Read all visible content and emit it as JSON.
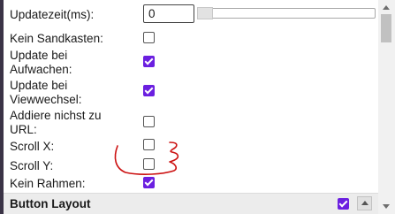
{
  "settings": {
    "update_interval": {
      "label": "Updatezeit(ms):",
      "value": "0",
      "slider_level": 0
    },
    "rows": [
      {
        "label_lines": [
          "Kein Sandkasten:"
        ],
        "checked": false
      },
      {
        "label_lines": [
          "Update bei",
          "Aufwachen:"
        ],
        "checked": true
      },
      {
        "label_lines": [
          "Update bei",
          "Viewwechsel:"
        ],
        "checked": true
      },
      {
        "label_lines": [
          "Addiere nichst zu",
          "URL:"
        ],
        "checked": false
      },
      {
        "label_lines": [
          "Scroll X:"
        ],
        "checked": false
      },
      {
        "label_lines": [
          "Scroll Y:"
        ],
        "checked": false
      },
      {
        "label_lines": [
          "Kein Rahmen:"
        ],
        "checked": true
      }
    ]
  },
  "section": {
    "title": "Button Layout",
    "checked": true,
    "collapse_icon": "chevron-up-icon"
  },
  "colors": {
    "accent": "#6b1fe0",
    "annotation": "#cc1111"
  },
  "scrollbar": {
    "up_icon": "scroll-up-arrow-icon",
    "down_icon": "scroll-down-arrow-icon"
  }
}
